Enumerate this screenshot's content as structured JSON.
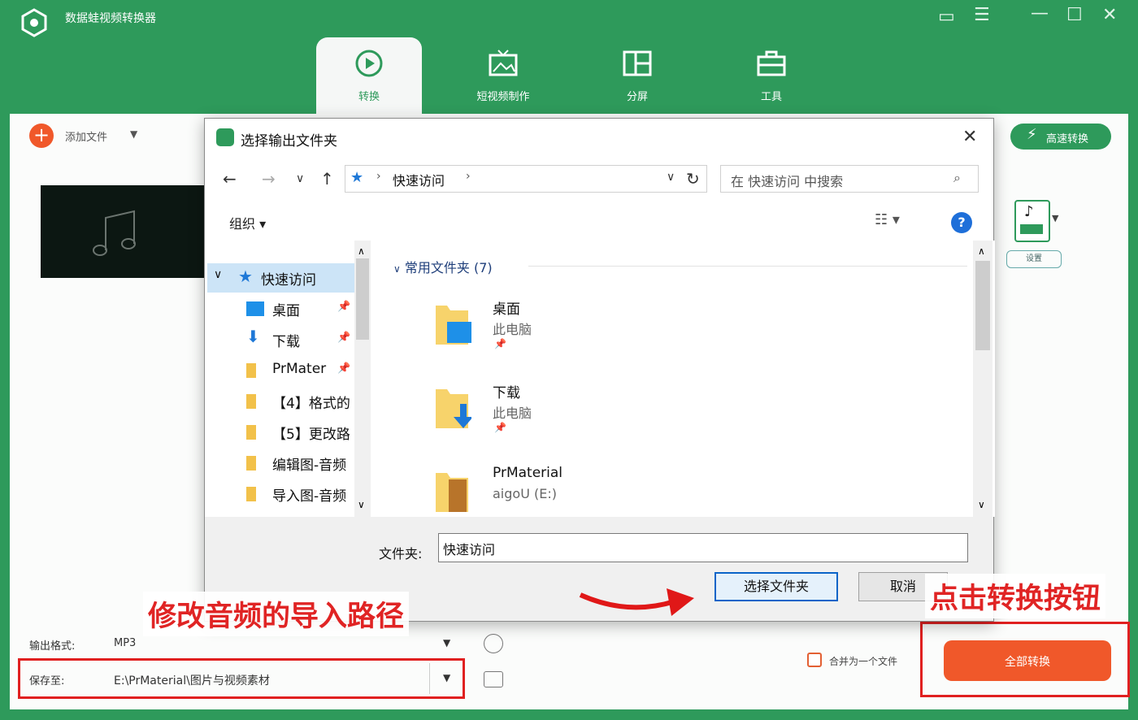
{
  "app": {
    "title": "数据蛙视频转换器",
    "accent_color": "#2e9a5b",
    "tabs": [
      {
        "label": "转换",
        "icon": "convert-icon"
      },
      {
        "label": "短视频制作",
        "icon": "video-maker-icon"
      },
      {
        "label": "分屏",
        "icon": "split-screen-icon"
      },
      {
        "label": "工具",
        "icon": "toolbox-icon"
      }
    ],
    "active_tab": "转换",
    "add_file_label": "添加文件",
    "speed_convert_label": "高速转换",
    "format_badge_label": "设置",
    "output_format_label": "输出格式:",
    "output_format_value": "MP3",
    "save_to_label": "保存至:",
    "save_to_value": "E:\\PrMaterial\\图片与视频素材",
    "merge_label": "合并为一个文件",
    "convert_all_label": "全部转换"
  },
  "annotations": {
    "left_callout": "修改音频的导入路径",
    "right_callout": "点击转换按钮",
    "highlight_color": "#e02020"
  },
  "dialog": {
    "title": "选择输出文件夹",
    "address": "快速访问",
    "search_placeholder": "在 快速访问 中搜索",
    "organize_label": "组织 ▾",
    "tree": [
      {
        "label": "快速访问",
        "icon": "star-icon"
      },
      {
        "label": "桌面",
        "icon": "desktop-icon"
      },
      {
        "label": "下载",
        "icon": "download-icon"
      },
      {
        "label": "PrMater",
        "icon": "folder-icon"
      },
      {
        "label": "【4】格式的",
        "icon": "folder-icon"
      },
      {
        "label": "【5】更改路",
        "icon": "folder-icon"
      },
      {
        "label": "编辑图-音频",
        "icon": "folder-icon"
      },
      {
        "label": "导入图-音频",
        "icon": "folder-icon"
      }
    ],
    "group_header": "常用文件夹 (7)",
    "files": [
      {
        "name": "桌面",
        "location": "此电脑"
      },
      {
        "name": "下载",
        "location": "此电脑"
      },
      {
        "name": "PrMaterial",
        "location": "aigoU (E:)"
      }
    ],
    "folder_label": "文件夹:",
    "folder_value": "快速访问",
    "select_button": "选择文件夹",
    "cancel_button": "取消"
  }
}
